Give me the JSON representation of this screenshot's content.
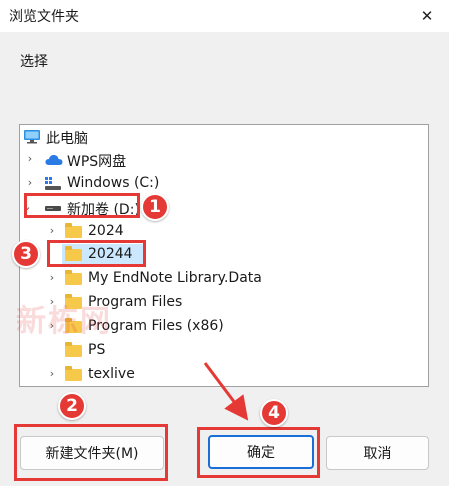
{
  "window": {
    "title": "浏览文件夹",
    "close_symbol": "✕"
  },
  "instruction": "选择",
  "tree": {
    "items": [
      {
        "label": "此电脑",
        "icon": "computer-icon"
      },
      {
        "label": "WPS网盘",
        "icon": "cloud-icon",
        "expand": "›"
      },
      {
        "label": "Windows (C:)",
        "icon": "windows-drive-icon",
        "expand": "›"
      },
      {
        "label": "新加卷 (D:)",
        "icon": "drive-icon",
        "expand": "⌄"
      },
      {
        "label": "2024",
        "icon": "folder-icon",
        "expand": "›"
      },
      {
        "label": "20244",
        "icon": "folder-icon",
        "selected": true
      },
      {
        "label": "My EndNote Library.Data",
        "icon": "folder-icon",
        "expand": "›"
      },
      {
        "label": "Program Files",
        "icon": "folder-icon",
        "expand": "›"
      },
      {
        "label": "Program Files (x86)",
        "icon": "folder-icon",
        "expand": "›"
      },
      {
        "label": "PS",
        "icon": "folder-icon"
      },
      {
        "label": "texlive",
        "icon": "folder-icon",
        "expand": "›"
      }
    ]
  },
  "buttons": {
    "new_folder": "新建文件夹(M)",
    "ok": "确定",
    "cancel": "取消"
  },
  "annotations": {
    "badge1": "1",
    "badge2": "2",
    "badge3": "3",
    "badge4": "4",
    "color": "#e53935"
  },
  "watermark": "新栋网",
  "colors": {
    "selection": "#cce8ff",
    "accent": "#1a6ed8",
    "folder": "#f7c94b"
  }
}
